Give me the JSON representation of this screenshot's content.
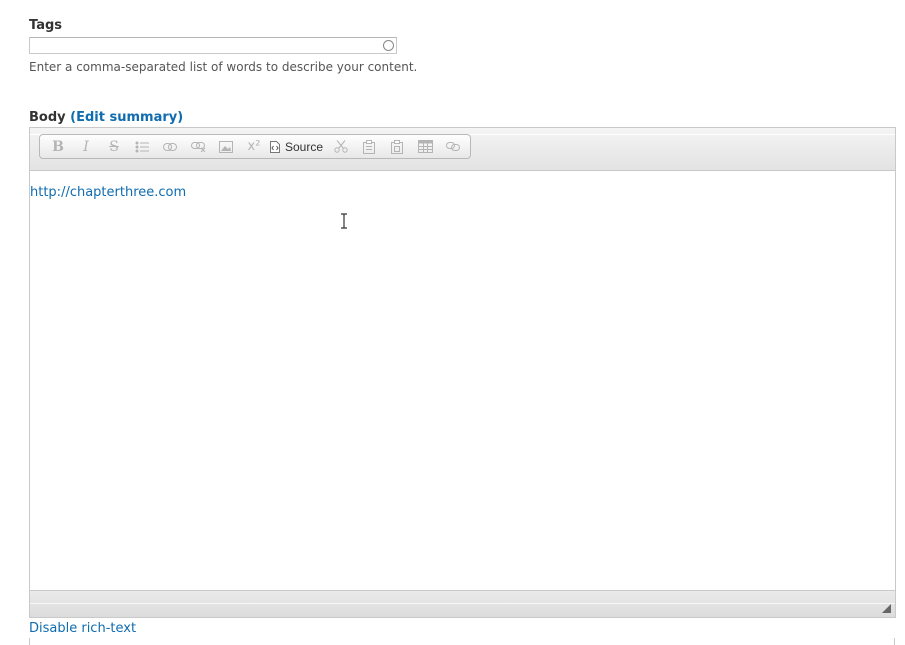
{
  "tags": {
    "label": "Tags",
    "value": "",
    "description": "Enter a comma-separated list of words to describe your content."
  },
  "body": {
    "label": "Body",
    "paren_open": "(",
    "edit_summary": "Edit summary",
    "paren_close": ")",
    "content_link": "http://chapterthree.com",
    "disable_rich_text": "Disable rich-text"
  },
  "toolbar": {
    "bold": "B",
    "italic": "I",
    "strike": "S",
    "superscript": "x²",
    "source": "Source"
  }
}
